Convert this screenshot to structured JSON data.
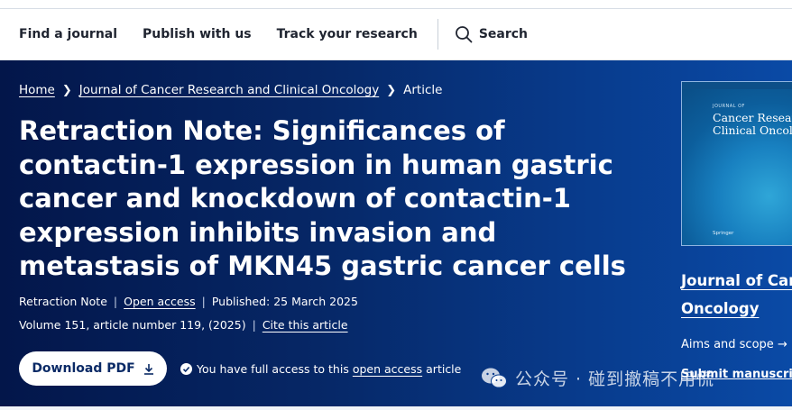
{
  "topnav": {
    "links": [
      "Find a journal",
      "Publish with us",
      "Track your research"
    ],
    "search_label": "Search"
  },
  "breadcrumb": {
    "home": "Home",
    "journal": "Journal of Cancer Research and Clinical Oncology",
    "current": "Article"
  },
  "article": {
    "title": "Retraction Note: Significances of contactin-1 expression in human gastric cancer and knockdown of contactin-1 expression inhibits invasion and metastasis of MKN45 gastric cancer cells",
    "type": "Retraction Note",
    "access_label": "Open access",
    "published": "Published: 25 March 2025",
    "volume_info": "Volume 151, article number 119, (2025)",
    "cite_label": "Cite this article",
    "download_label": "Download PDF",
    "access_prefix": "You have full access to this",
    "access_link": "open access",
    "access_suffix": "article"
  },
  "sidebar": {
    "cover_small": "JOURNAL OF",
    "cover_title_1": "Cancer Research",
    "cover_title_2": "Clinical Oncology",
    "cover_publisher": "Springer",
    "journal_title_1": "Journal of Canc",
    "journal_title_2": "Oncology",
    "aims_label": "Aims and scope",
    "aims_arrow": "→",
    "submit_label": "Submit manuscript"
  },
  "watermark": {
    "text": "公众号 · 碰到撤稿不用慌"
  },
  "colors": {
    "hero_dark": "#03164a",
    "hero_light": "#0a4aa6",
    "button_text": "#0a2a66"
  }
}
